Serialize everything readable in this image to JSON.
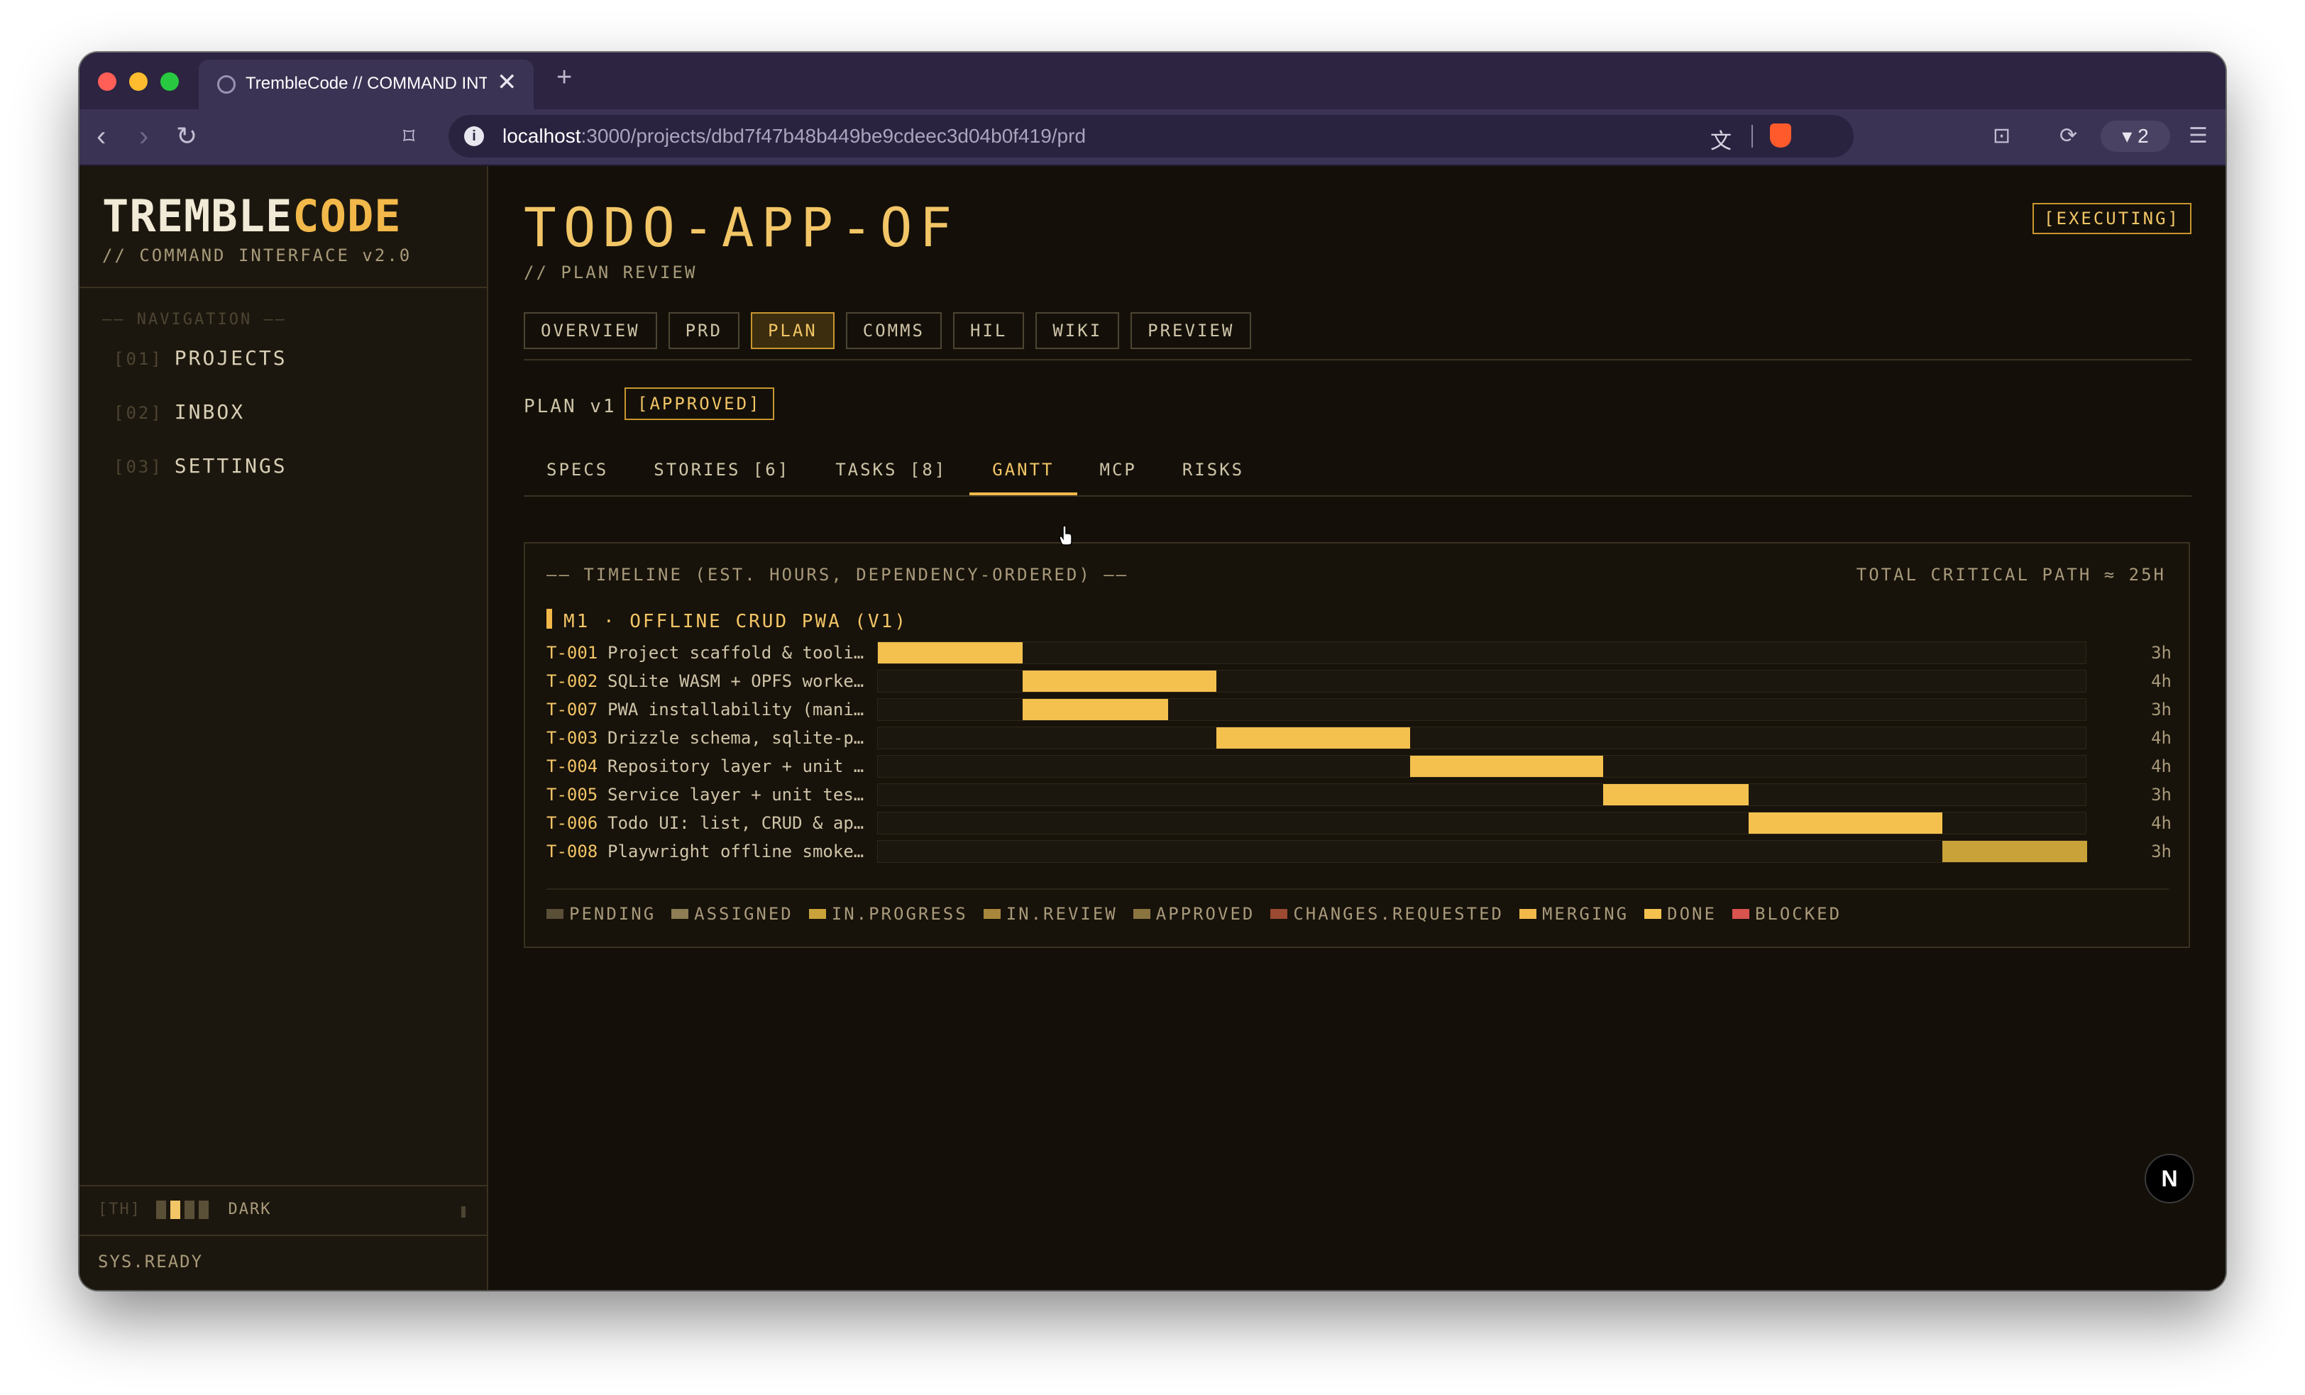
{
  "browser": {
    "tab_title": "TrembleCode // COMMAND INTERFACE",
    "tab_close": "✕",
    "new_tab": "+",
    "url_host": "localhost",
    "url_path": ":3000/projects/dbd7f47b48b449be9cdeec3d04b0f419/prd",
    "wallet_count": "2"
  },
  "sidebar": {
    "brand_main": "TREMBLE",
    "brand_accent": "CODE",
    "brand_sub": "// COMMAND INTERFACE v2.0",
    "nav_heading": "—— NAVIGATION ——",
    "items": [
      {
        "num": "[01]",
        "label": "PROJECTS"
      },
      {
        "num": "[02]",
        "label": "INBOX"
      },
      {
        "num": "[03]",
        "label": "SETTINGS"
      }
    ],
    "theme_tag": "[TH]",
    "theme_label": "DARK",
    "status": "SYS.READY"
  },
  "project": {
    "title": "TODO-APP-OF",
    "subtitle": "// PLAN REVIEW",
    "status_badge": "[EXECUTING]",
    "tabs": [
      "OVERVIEW",
      "PRD",
      "PLAN",
      "COMMS",
      "HIL",
      "WIKI",
      "PREVIEW"
    ],
    "active_tab": "PLAN"
  },
  "plan": {
    "version_label": "PLAN v1",
    "approval_badge": "[APPROVED]",
    "subtabs": [
      "SPECS",
      "STORIES [6]",
      "TASKS [8]",
      "GANTT",
      "MCP",
      "RISKS"
    ],
    "active_subtab": "GANTT"
  },
  "gantt": {
    "heading": "—— TIMELINE (EST. HOURS, DEPENDENCY-ORDERED) ——",
    "total": "TOTAL CRITICAL PATH ≈ 25H",
    "milestone": "M1 · OFFLINE CRUD PWA (V1)",
    "total_hours": 25,
    "tasks": [
      {
        "id": "T-001",
        "name": "Project scaffold & tooli…",
        "start": 0,
        "hours": 3,
        "duration": "3h",
        "color": "#f4c14f"
      },
      {
        "id": "T-002",
        "name": "SQLite WASM + OPFS worke…",
        "start": 3,
        "hours": 4,
        "duration": "4h",
        "color": "#f4c14f"
      },
      {
        "id": "T-007",
        "name": "PWA installability (mani…",
        "start": 3,
        "hours": 3,
        "duration": "3h",
        "color": "#f4c14f"
      },
      {
        "id": "T-003",
        "name": "Drizzle schema, sqlite-p…",
        "start": 7,
        "hours": 4,
        "duration": "4h",
        "color": "#f4c14f"
      },
      {
        "id": "T-004",
        "name": "Repository layer + unit …",
        "start": 11,
        "hours": 4,
        "duration": "4h",
        "color": "#f4c14f"
      },
      {
        "id": "T-005",
        "name": "Service layer + unit tes…",
        "start": 15,
        "hours": 3,
        "duration": "3h",
        "color": "#f4c14f"
      },
      {
        "id": "T-006",
        "name": "Todo UI: list, CRUD & ap…",
        "start": 18,
        "hours": 4,
        "duration": "4h",
        "color": "#f4c14f"
      },
      {
        "id": "T-008",
        "name": "Playwright offline smoke…",
        "start": 22,
        "hours": 3,
        "duration": "3h",
        "color": "#c9a23a"
      }
    ],
    "legend": [
      {
        "label": "PENDING",
        "color": "#5a5038"
      },
      {
        "label": "ASSIGNED",
        "color": "#8f7e55"
      },
      {
        "label": "IN.PROGRESS",
        "color": "#c9a23a"
      },
      {
        "label": "IN.REVIEW",
        "color": "#a8873c"
      },
      {
        "label": "APPROVED",
        "color": "#8a7440"
      },
      {
        "label": "CHANGES.REQUESTED",
        "color": "#9c4a32"
      },
      {
        "label": "MERGING",
        "color": "#f2b84a"
      },
      {
        "label": "DONE",
        "color": "#f4c14f"
      },
      {
        "label": "BLOCKED",
        "color": "#d9534f"
      }
    ]
  },
  "footer_badge": "N"
}
